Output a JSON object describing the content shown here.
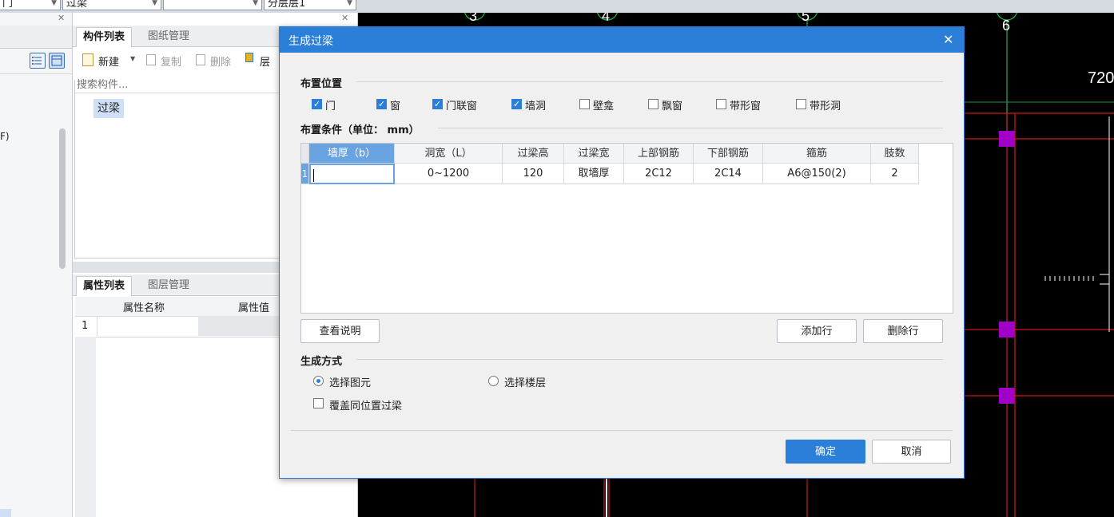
{
  "toolbar": {
    "combo1": "门",
    "combo2": "过梁",
    "combo3": "",
    "combo4": "分层层1"
  },
  "left_panel": {
    "text_f": "F)"
  },
  "component_panel": {
    "tabs": [
      "构件列表",
      "图纸管理"
    ],
    "toolbar": {
      "new_label": "新建",
      "copy_label": "复制",
      "delete_label": "删除",
      "layer_label": "层"
    },
    "search_placeholder": "搜索构件...",
    "items": [
      "过梁"
    ]
  },
  "property_panel": {
    "tabs": [
      "属性列表",
      "图层管理"
    ],
    "headers": [
      "属性名称",
      "属性值"
    ],
    "rows": [
      {
        "num": "1",
        "name": "",
        "value": ""
      }
    ]
  },
  "canvas": {
    "axis_labels": [
      "3",
      "4",
      "5",
      "6"
    ],
    "dimension_text": "720"
  },
  "dialog": {
    "title": "生成过梁",
    "close_icon": "close-icon",
    "placement_position": {
      "title": "布置位置",
      "options": [
        {
          "label": "门",
          "checked": true
        },
        {
          "label": "窗",
          "checked": true
        },
        {
          "label": "门联窗",
          "checked": true
        },
        {
          "label": "墙洞",
          "checked": true
        },
        {
          "label": "壁龛",
          "checked": false
        },
        {
          "label": "飘窗",
          "checked": false
        },
        {
          "label": "带形窗",
          "checked": false
        },
        {
          "label": "带形洞",
          "checked": false
        }
      ]
    },
    "placement_conditions": {
      "title": "布置条件（单位： mm）",
      "columns": [
        "墙厚（b）",
        "洞宽（L）",
        "过梁高",
        "过梁宽",
        "上部钢筋",
        "下部钢筋",
        "箍筋",
        "肢数"
      ],
      "rows": [
        {
          "num": "1",
          "cells": [
            "",
            "0~1200",
            "120",
            "取墙厚",
            "2C12",
            "2C14",
            "A6@150(2)",
            "2"
          ]
        }
      ]
    },
    "buttons": {
      "view_help": "查看说明",
      "add_row": "添加行",
      "delete_row": "删除行",
      "ok": "确定",
      "cancel": "取消"
    },
    "generation_method": {
      "title": "生成方式",
      "radio_options": [
        {
          "label": "选择图元",
          "selected": true
        },
        {
          "label": "选择楼层",
          "selected": false
        }
      ],
      "overwrite_label": "覆盖同位置过梁",
      "overwrite_checked": false
    }
  },
  "colors": {
    "accent": "#2b7fd8",
    "canvas_bg": "#000000",
    "grid_red": "#d11a1a",
    "grid_green": "#1fb84a",
    "marker_magenta": "#a100c8"
  }
}
